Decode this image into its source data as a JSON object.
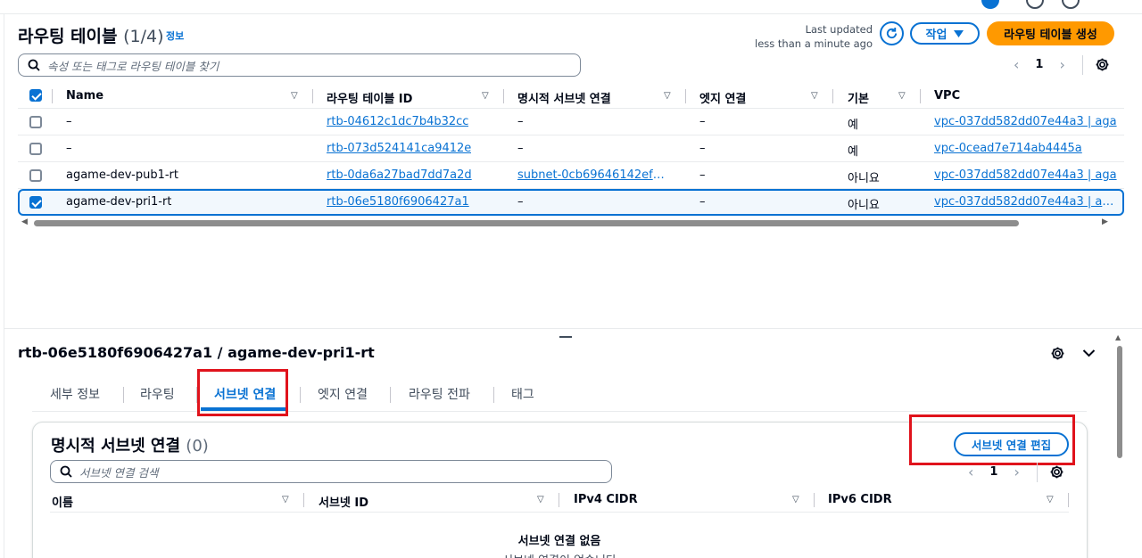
{
  "header": {
    "title": "라우팅 테이블",
    "count": "(1/4)",
    "info_label": "정보",
    "last_updated_label": "Last updated",
    "last_updated_value": "less than a minute ago",
    "actions_label": "작업",
    "create_label": "라우팅 테이블 생성"
  },
  "search": {
    "placeholder": "속성 또는 태그로 라우팅 테이블 찾기"
  },
  "pagination": {
    "page": "1"
  },
  "table": {
    "columns": [
      "Name",
      "라우팅 테이블 ID",
      "명시적 서브넷 연결",
      "엣지 연결",
      "기본",
      "VPC"
    ],
    "rows": [
      {
        "name": "–",
        "id": "rtb-04612c1dc7b4b32cc",
        "subnet": "–",
        "edge": "–",
        "main": "예",
        "vpc": "vpc-037dd582dd07e44a3 | aga",
        "selected": false
      },
      {
        "name": "–",
        "id": "rtb-073d524141ca9412e",
        "subnet": "–",
        "edge": "–",
        "main": "예",
        "vpc": "vpc-0cead7e714ab4445a",
        "selected": false
      },
      {
        "name": "agame-dev-pub1-rt",
        "id": "rtb-0da6a27bad7dd7a2d",
        "subnet": "subnet-0cb69646142ef7…",
        "edge": "–",
        "main": "아니요",
        "vpc": "vpc-037dd582dd07e44a3 | aga",
        "selected": false
      },
      {
        "name": "agame-dev-pri1-rt",
        "id": "rtb-06e5180f6906427a1",
        "subnet": "–",
        "edge": "–",
        "main": "아니요",
        "vpc": "vpc-037dd582dd07e44a3 | aga",
        "selected": true
      }
    ]
  },
  "detail": {
    "title": "rtb-06e5180f6906427a1 / agame-dev-pri1-rt",
    "tabs": [
      "세부 정보",
      "라우팅",
      "서브넷 연결",
      "엣지 연결",
      "라우팅 전파",
      "태그"
    ],
    "active_tab": "서브넷 연결",
    "panel": {
      "title": "명시적 서브넷 연결",
      "count": "(0)",
      "edit_label": "서브넷 연결 편집",
      "search_placeholder": "서브넷 연결 검색",
      "page": "1",
      "columns": [
        "이름",
        "서브넷 ID",
        "IPv4 CIDR",
        "IPv6 CIDR"
      ],
      "empty_title": "서브넷 연결 없음",
      "empty_desc": "서브넷 연결이 없습니다"
    }
  },
  "colors": {
    "accent": "#0972d3",
    "primary": "#ff9900",
    "highlight": "#e0131c"
  }
}
